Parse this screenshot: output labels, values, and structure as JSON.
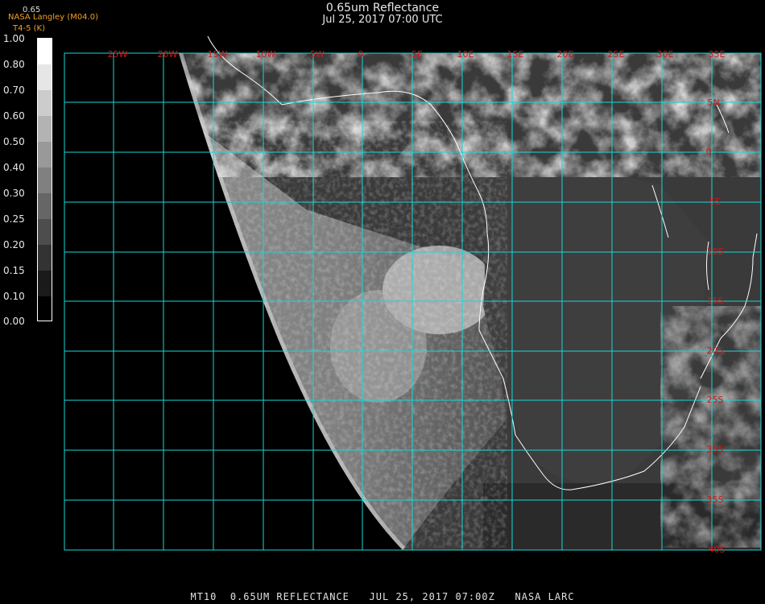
{
  "title": "0.65um Reflectance",
  "subtitle": "Jul 25, 2017 07:00 UTC",
  "credit_top": "0.65",
  "credit": "NASA Langley (M04.0)",
  "credit2": "T4-5 (K)",
  "colorbar": {
    "labels": [
      "1.00",
      "0.80",
      "0.70",
      "0.60",
      "0.50",
      "0.40",
      "0.30",
      "0.25",
      "0.20",
      "0.15",
      "0.10",
      "0.00"
    ]
  },
  "grid": {
    "lon_labels": [
      "25W",
      "20W",
      "15W",
      "10W",
      "5W",
      "0",
      "5E",
      "10E",
      "15E",
      "20E",
      "25E",
      "30E",
      "35E"
    ],
    "lat_labels": [
      "5N",
      "0",
      "5S",
      "10S",
      "15S",
      "20S",
      "25S",
      "30S",
      "35S",
      "40S"
    ]
  },
  "bottom_caption": "MT10  0.65UM REFLECTANCE   JUL 25, 2017 07:00Z   NASA LARC",
  "colors": {
    "grid": "#19d7d7",
    "labels": "#d01818",
    "coast": "#ffffff",
    "credit": "#f0a020"
  }
}
